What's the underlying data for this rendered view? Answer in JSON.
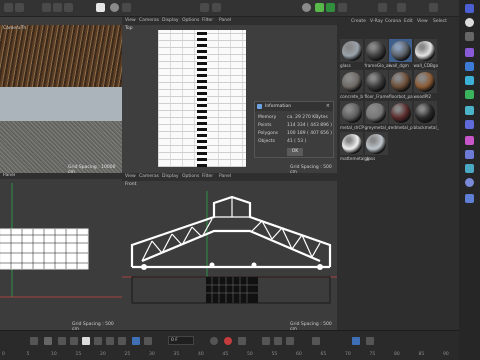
{
  "views": {
    "perspective": {
      "camera_label": "CameraTh",
      "grid_spacing": "Grid Spacing : 10000 cm"
    },
    "top": {
      "label": "Top",
      "menu": [
        "View",
        "Cameras",
        "Display",
        "Options",
        "Filter",
        "Panel"
      ]
    },
    "right": {
      "label": "Panel",
      "grid_spacing": "Grid Spacing : 500 cm"
    },
    "front": {
      "label": "Front",
      "menu": [
        "View",
        "Cameras",
        "Display",
        "Options",
        "Filter",
        "Panel"
      ],
      "grid_spacing": "Grid Spacing : 500 cm"
    },
    "top_grid_spacing": "Grid Spacing : 500 cm"
  },
  "info_dialog": {
    "title": "Information",
    "rows": [
      {
        "label": "Memory",
        "value": "ca. 29 270 KBytes"
      },
      {
        "label": "Points",
        "value": "114 334 ( 443 896 )"
      },
      {
        "label": "Polygons",
        "value": "100 189 ( 407 656 )"
      },
      {
        "label": "Objects",
        "value": "41 ( 53 )"
      }
    ],
    "ok_label": "OK"
  },
  "material_panel": {
    "menu": [
      "Create",
      "V-Ray",
      "Corona",
      "Edit",
      "View",
      "Select"
    ],
    "materials": [
      {
        "name": "glass",
        "color": "#9aa3ab"
      },
      {
        "name": "frameGlo_al",
        "color": "#3e3e3e"
      },
      {
        "name": "wall_dgm",
        "color": "#5a5f66"
      },
      {
        "name": "wall_CDBgo",
        "color": "#e5e5e5"
      },
      {
        "name": "concrete_b",
        "color": "#6e6a65"
      },
      {
        "name": "floor_Frame",
        "color": "#3a3a3a"
      },
      {
        "name": "floorbot_pa",
        "color": "#6b4c35"
      },
      {
        "name": "woodPl2",
        "color": "#8a5a33"
      },
      {
        "name": "metal_drCP",
        "color": "#5e5e5e"
      },
      {
        "name": "greymetal_c",
        "color": "#767676"
      },
      {
        "name": "redmetal_p",
        "color": "#5a2a2a"
      },
      {
        "name": "blackmetal_",
        "color": "#2a2a2a"
      },
      {
        "name": "mattemetal_g",
        "color": "#f0f0f0"
      },
      {
        "name": "glass",
        "color": "#bfc6cc"
      }
    ]
  },
  "timeline": {
    "current_frame": "0 F",
    "ruler": [
      "0",
      "5",
      "10",
      "15",
      "20",
      "25",
      "30",
      "35",
      "40",
      "45",
      "50",
      "55",
      "60",
      "65",
      "70",
      "75",
      "80",
      "85",
      "90"
    ]
  }
}
